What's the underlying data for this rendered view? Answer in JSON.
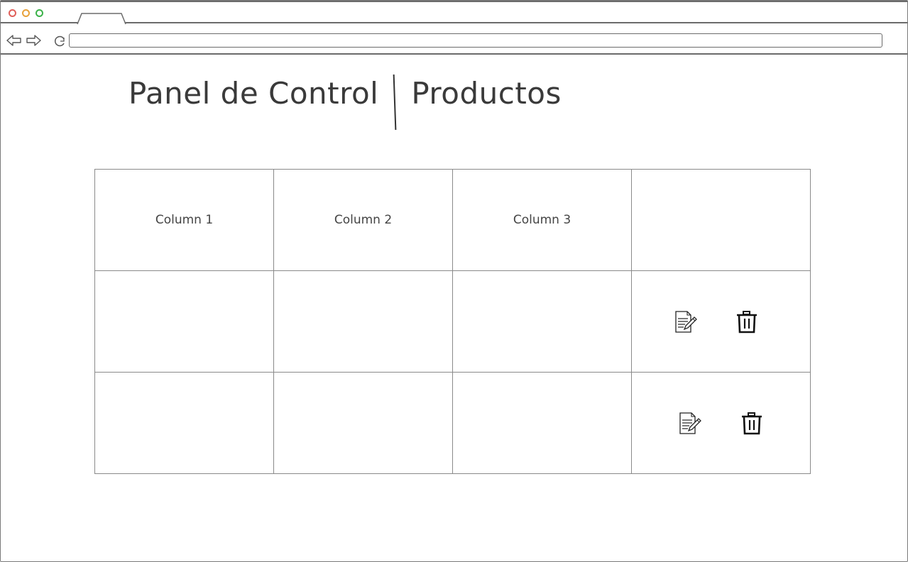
{
  "page": {
    "title_left": "Panel de Control",
    "title_right": "Productos"
  },
  "table": {
    "columns": [
      "Column 1",
      "Column 2",
      "Column 3",
      ""
    ],
    "rows": [
      {
        "cells": [
          "",
          "",
          ""
        ],
        "actions": [
          "edit-icon",
          "delete-icon"
        ]
      },
      {
        "cells": [
          "",
          "",
          ""
        ],
        "actions": [
          "edit-icon",
          "delete-icon"
        ]
      }
    ]
  },
  "colors": {
    "close": "#e0605a",
    "minimize": "#e8a23a",
    "maximize": "#3cb24a",
    "chrome_border": "#6b6b6b",
    "grid_line": "#8a8a8a"
  }
}
